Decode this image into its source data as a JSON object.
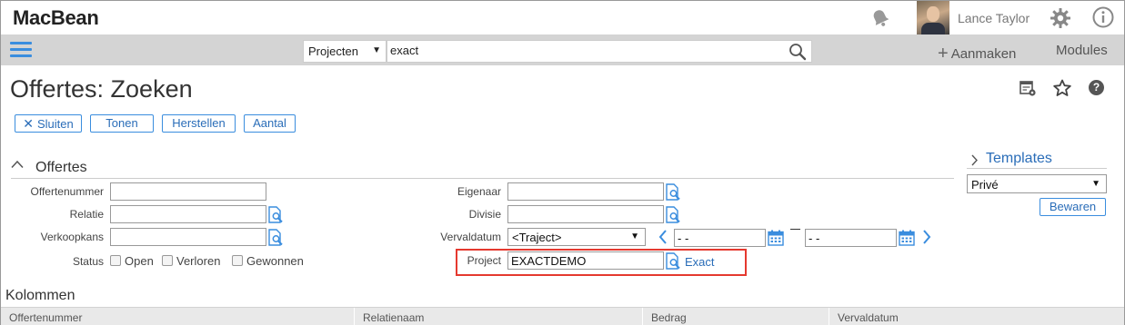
{
  "app": {
    "logo": "MacBean"
  },
  "user": {
    "name": "Lance Taylor"
  },
  "search": {
    "scope": "Projecten",
    "query": "exact"
  },
  "nav": {
    "create_label": "Aanmaken",
    "modules_label": "Modules"
  },
  "page": {
    "title": "Offertes: Zoeken"
  },
  "actions": {
    "close": "Sluiten",
    "show": "Tonen",
    "reset": "Herstellen",
    "count": "Aantal"
  },
  "section": {
    "title": "Offertes"
  },
  "form": {
    "offertenummer": {
      "label": "Offertenummer",
      "value": ""
    },
    "relatie": {
      "label": "Relatie",
      "value": ""
    },
    "verkoopkans": {
      "label": "Verkoopkans",
      "value": ""
    },
    "status": {
      "label": "Status",
      "options": [
        {
          "label": "Open",
          "checked": false
        },
        {
          "label": "Verloren",
          "checked": false
        },
        {
          "label": "Gewonnen",
          "checked": false
        }
      ]
    },
    "eigenaar": {
      "label": "Eigenaar",
      "value": ""
    },
    "divisie": {
      "label": "Divisie",
      "value": ""
    },
    "vervaldatum": {
      "label": "Vervaldatum",
      "range": "<Traject>",
      "from": "-  -",
      "to": "-  -"
    },
    "project": {
      "label": "Project",
      "value": "EXACTDEMO",
      "resolved": "Exact"
    }
  },
  "templates": {
    "title": "Templates",
    "selected": "Privé",
    "save": "Bewaren"
  },
  "columns": {
    "title": "Kolommen",
    "headers": [
      "Offertenummer",
      "Relatienaam",
      "Bedrag",
      "Vervaldatum"
    ]
  },
  "colors": {
    "accent": "#3a8dde",
    "link": "#2a6db8",
    "highlight": "#e5392f",
    "navbar": "#d4d4d4"
  }
}
